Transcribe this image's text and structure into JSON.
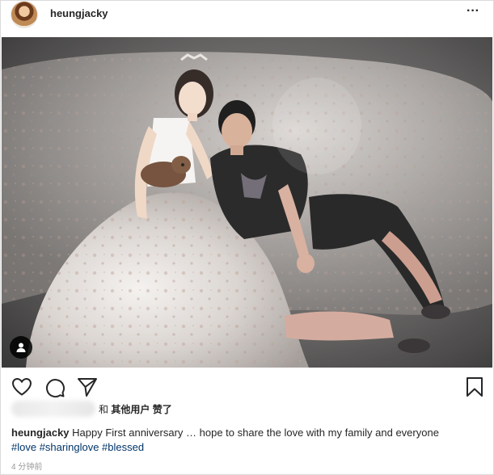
{
  "post": {
    "username": "heungjacky",
    "more_icon": "more-horizontal-icon"
  },
  "actions": {
    "like_icon": "heart-icon",
    "comment_icon": "comment-icon",
    "share_icon": "send-icon",
    "save_icon": "bookmark-icon"
  },
  "likes": {
    "prefix": "和",
    "others": "其他用户",
    "suffix": "赞了"
  },
  "caption": {
    "username": "heungjacky",
    "text": "Happy First anniversary … hope to share the love with my family and everyone",
    "hashtags": [
      "#love",
      "#sharinglove",
      "#blessed"
    ]
  },
  "timestamp": "4 分钟前",
  "colors": {
    "text": "#262626",
    "hashtag": "#003569",
    "muted": "#999999",
    "border": "#dbdbdb"
  }
}
